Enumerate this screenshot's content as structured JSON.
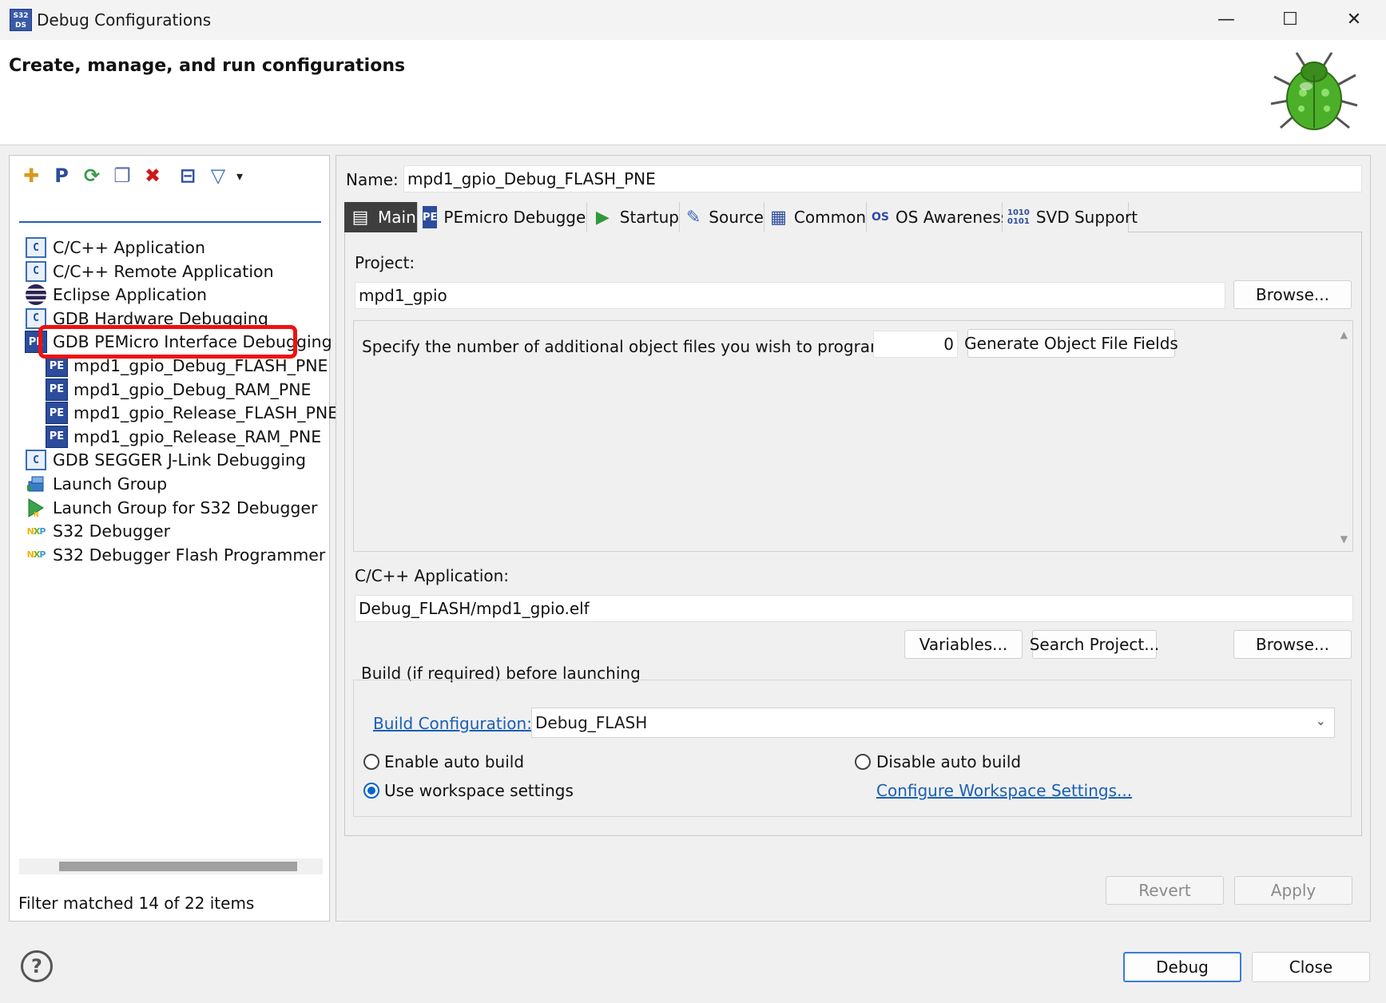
{
  "window": {
    "title": "Debug Configurations",
    "app_icon": "S32 DS",
    "minimize_glyph": "—",
    "maximize_glyph": "☐",
    "close_glyph": "✕"
  },
  "banner": {
    "title": "Create, manage, and run configurations",
    "icon": "bug-icon"
  },
  "left": {
    "toolbar": [
      {
        "name": "new-configuration-icon",
        "glyph": "✚"
      },
      {
        "name": "new-prototype-icon",
        "glyph": "P"
      },
      {
        "name": "export-icon",
        "glyph": "⟳"
      },
      {
        "name": "duplicate-icon",
        "glyph": "❐"
      },
      {
        "name": "delete-icon",
        "glyph": "✖"
      },
      {
        "name": "collapse-all-icon",
        "glyph": "⊟"
      },
      {
        "name": "filter-icon",
        "glyph": "▽"
      },
      {
        "name": "filter-menu-chevron-icon",
        "glyph": "▾"
      }
    ],
    "filter_value": "",
    "tree": [
      {
        "label": "C/C++ Application",
        "icon": "c-icon"
      },
      {
        "label": "C/C++ Remote Application",
        "icon": "c-icon"
      },
      {
        "label": "Eclipse Application",
        "icon": "eclipse-icon"
      },
      {
        "label": "GDB Hardware Debugging",
        "icon": "c-icon"
      },
      {
        "label": "GDB PEMicro Interface Debugging",
        "icon": "pe-icon"
      },
      {
        "label": "mpd1_gpio_Debug_FLASH_PNE",
        "icon": "pe-icon"
      },
      {
        "label": "mpd1_gpio_Debug_RAM_PNE",
        "icon": "pe-icon"
      },
      {
        "label": "mpd1_gpio_Release_FLASH_PNE",
        "icon": "pe-icon"
      },
      {
        "label": "mpd1_gpio_Release_RAM_PNE",
        "icon": "pe-icon"
      },
      {
        "label": "GDB SEGGER J-Link Debugging",
        "icon": "c-icon"
      },
      {
        "label": "Launch Group",
        "icon": "launch-group-icon"
      },
      {
        "label": "Launch Group for S32 Debugger",
        "icon": "launch-group-s32-icon"
      },
      {
        "label": "S32 Debugger",
        "icon": "nxp-icon"
      },
      {
        "label": "S32 Debugger Flash Programmer",
        "icon": "nxp-icon"
      }
    ],
    "pe_icon_text": "PE",
    "c_icon_text": "C",
    "nxp_text": {
      "n": "N",
      "x": "X",
      "p": "P"
    },
    "status": "Filter matched 14 of 22 items"
  },
  "right": {
    "name_label": "Name:",
    "name_value": "mpd1_gpio_Debug_FLASH_PNE",
    "tabs": [
      {
        "label": "Main",
        "icon": "main-tab-icon",
        "glyph": "▤"
      },
      {
        "label": "PEmicro Debugger",
        "icon": "pe-icon",
        "glyph": "PE"
      },
      {
        "label": "Startup",
        "icon": "startup-icon",
        "glyph": "▶"
      },
      {
        "label": "Source",
        "icon": "source-icon",
        "glyph": "✎"
      },
      {
        "label": "Common",
        "icon": "common-icon",
        "glyph": "▦"
      },
      {
        "label": "OS Awareness",
        "icon": "os-icon",
        "glyph": "OS"
      },
      {
        "label": "SVD Support",
        "icon": "svd-icon",
        "glyph": "1010\n0101"
      }
    ],
    "project_label": "Project:",
    "project_value": "mpd1_gpio",
    "browse_label": "Browse...",
    "object_files_label": "Specify the number of additional object files you wish to program:",
    "object_files_value": "0",
    "generate_label": "Generate Object File Fields",
    "scroll_up_glyph": "▲",
    "scroll_down_glyph": "▼",
    "app_label": "C/C++ Application:",
    "app_value": "Debug_FLASH/mpd1_gpio.elf",
    "variables_label": "Variables...",
    "search_project_label": "Search Project...",
    "browse2_label": "Browse...",
    "build_group_label": "Build (if required) before launching",
    "build_config_link": "Build Configuration:",
    "build_config_value": "Debug_FLASH",
    "combo_chevron": "⌄",
    "enable_auto_build": "Enable auto build",
    "disable_auto_build": "Disable auto build",
    "use_workspace": "Use workspace settings",
    "configure_workspace_link": "Configure Workspace Settings...",
    "revert_label": "Revert",
    "apply_label": "Apply"
  },
  "bottom": {
    "help_glyph": "?",
    "debug_label": "Debug",
    "close_label": "Close"
  },
  "colors": {
    "accent": "#0a64c8",
    "selection_highlight": "#ee1111",
    "active_tab": "#3e3e3e",
    "link": "#1a5fb4"
  }
}
